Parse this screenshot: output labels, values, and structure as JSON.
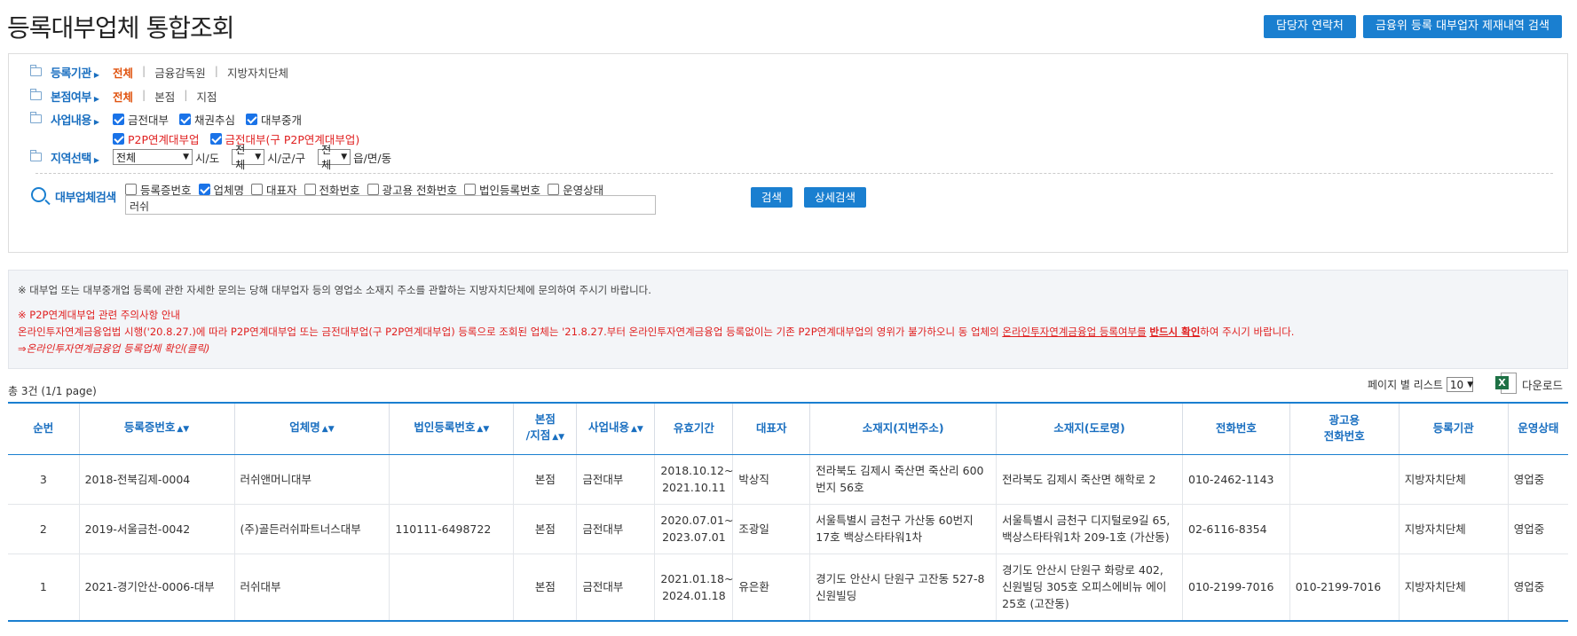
{
  "page_title": "등록대부업체 통합조회",
  "header_buttons": {
    "contact": "담당자 연락처",
    "sanctions": "금융위 등록 대부업자 제재내역 검색"
  },
  "filters": {
    "registrar": {
      "label": "등록기관",
      "options": [
        "전체",
        "금융감독원",
        "지방자치단체"
      ]
    },
    "branch": {
      "label": "본점여부",
      "options": [
        "전체",
        "본점",
        "지점"
      ]
    },
    "business": {
      "label": "사업내용",
      "row1": [
        "금전대부",
        "채권추심",
        "대부중개"
      ],
      "row2": [
        "P2P연계대부업",
        "금전대부(구 P2P연계대부업)"
      ]
    },
    "region": {
      "label": "지역선택",
      "sido_value": "전체",
      "sido_unit": "시/도",
      "sigungu_value": "전체",
      "sigungu_unit": "시/군/구",
      "eupmyeon_value": "전체",
      "eupmyeon_unit": "읍/면/동"
    }
  },
  "search": {
    "label": "대부업체검색",
    "fields": [
      {
        "label": "등록증번호",
        "checked": false
      },
      {
        "label": "업체명",
        "checked": true
      },
      {
        "label": "대표자",
        "checked": false
      },
      {
        "label": "전화번호",
        "checked": false
      },
      {
        "label": "광고용 전화번호",
        "checked": false
      },
      {
        "label": "법인등록번호",
        "checked": false
      },
      {
        "label": "운영상태",
        "checked": false
      }
    ],
    "value": "러쉬",
    "search_btn": "검색",
    "detail_btn": "상세검색"
  },
  "notice": {
    "line1": "※ 대부업 또는 대부중개업 등록에 관한 자세한 문의는 당해 대부업자 등의 영업소 소재지 주소를 관할하는 지방자치단체에 문의하여 주시기 바랍니다.",
    "line2": "※ P2P연계대부업 관련 주의사항 안내",
    "line3a": "온라인투자연계금융업법 시행('20.8.27.)에 따라 P2P연계대부업 또는 금전대부업(구 P2P연계대부업) 등록으로 조회된 업체는 '21.8.27.부터 온라인투자연계금융업 등록없이는 기존 P2P연계대부업의 영위가 불가하오니 동 업체의 ",
    "line3b": "온라인투자연계금융업 등록여부를",
    "line3c": " ",
    "line3d": "반드시 확인",
    "line3e": "하여 주시기 바랍니다.",
    "line4": "⇒온라인투자연계금융업 등록업체 확인(클릭)"
  },
  "result_count": "총 3건 (1/1 page)",
  "per_page_label": "페이지 별 리스트",
  "per_page_value": "10",
  "download_label": "다운로드",
  "table": {
    "headers": [
      "순번",
      "등록증번호",
      "업체명",
      "법인등록번호",
      "본점\n/지점",
      "사업내용",
      "유효기간",
      "대표자",
      "소재지(지번주소)",
      "소재지(도로명)",
      "전화번호",
      "광고용\n전화번호",
      "등록기관",
      "운영상태"
    ],
    "rows": [
      [
        "3",
        "2018-전북김제-0004",
        "러쉬앤머니대부",
        "",
        "본점",
        "금전대부",
        "2018.10.12~\n2021.10.11",
        "박상직",
        "전라북도 김제시 죽산면 죽산리 600번지 56호",
        "전라북도 김제시 죽산면 해학로 2",
        "010-2462-1143",
        "",
        "지방자치단체",
        "영업중"
      ],
      [
        "2",
        "2019-서울금천-0042",
        "(주)골든러쉬파트너스대부",
        "110111-6498722",
        "본점",
        "금전대부",
        "2020.07.01~\n2023.07.01",
        "조광일",
        "서울특별시 금천구 가산동 60번지 17호 백상스타타워1차",
        "서울특별시 금천구 디지털로9길 65, 백상스타타워1차 209-1호 (가산동)",
        "02-6116-8354",
        "",
        "지방자치단체",
        "영업중"
      ],
      [
        "1",
        "2021-경기안산-0006-대부",
        "러쉬대부",
        "",
        "본점",
        "금전대부",
        "2021.01.18~\n2024.01.18",
        "유은환",
        "경기도 안산시 단원구 고잔동 527-8 신원빌딩",
        "경기도 안산시 단원구 화랑로 402, 신원빌딩 305호 오피스에비뉴 에이25호 (고잔동)",
        "010-2199-7016",
        "010-2199-7016",
        "지방자치단체",
        "영업중"
      ]
    ]
  }
}
